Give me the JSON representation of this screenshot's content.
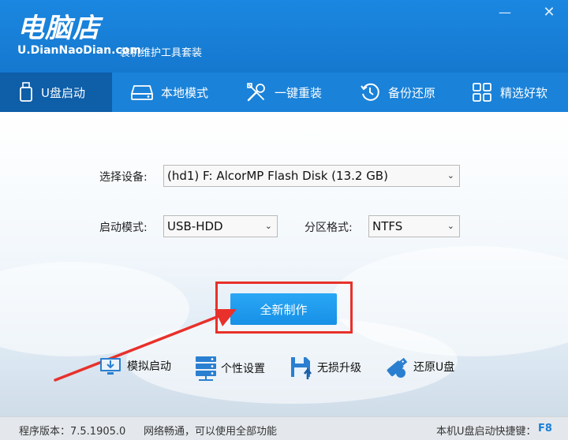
{
  "header": {
    "logo_cn": "电脑店",
    "logo_en": "U.DianNaoDian.com",
    "subtitle": "装机维护工具套装",
    "minimize_label": "—",
    "close_label": "✕"
  },
  "tabs": [
    {
      "label": "U盘启动",
      "icon": "usb-drive-icon",
      "active": true
    },
    {
      "label": "本地模式",
      "icon": "hard-disk-icon",
      "active": false
    },
    {
      "label": "一键重装",
      "icon": "tools-icon",
      "active": false
    },
    {
      "label": "备份还原",
      "icon": "history-icon",
      "active": false
    },
    {
      "label": "精选好软",
      "icon": "grid-icon",
      "active": false
    }
  ],
  "form": {
    "device_label": "选择设备:",
    "device_value": "(hd1) F: AlcorMP Flash Disk (13.2 GB)",
    "boot_mode_label": "启动模式:",
    "boot_mode_value": "USB-HDD",
    "partition_label": "分区格式:",
    "partition_value": "NTFS"
  },
  "primary_button": "全新制作",
  "tools": [
    {
      "label": "模拟启动",
      "icon": "monitor-download-icon"
    },
    {
      "label": "个性设置",
      "icon": "server-stack-icon"
    },
    {
      "label": "无损升级",
      "icon": "save-upload-icon"
    },
    {
      "label": "还原U盘",
      "icon": "usb-stick-icon"
    }
  ],
  "status_bar": {
    "version": "程序版本：7.5.1905.0",
    "network": "网络畅通，可以使用全部功能",
    "hotkey_label": "本机U盘启动快捷键：",
    "hotkey_value": "F8"
  },
  "colors": {
    "header_blue": "#1b87e0",
    "active_tab": "#0e5ea8",
    "button_blue": "#1690e6",
    "highlight_red": "#e8312b"
  }
}
